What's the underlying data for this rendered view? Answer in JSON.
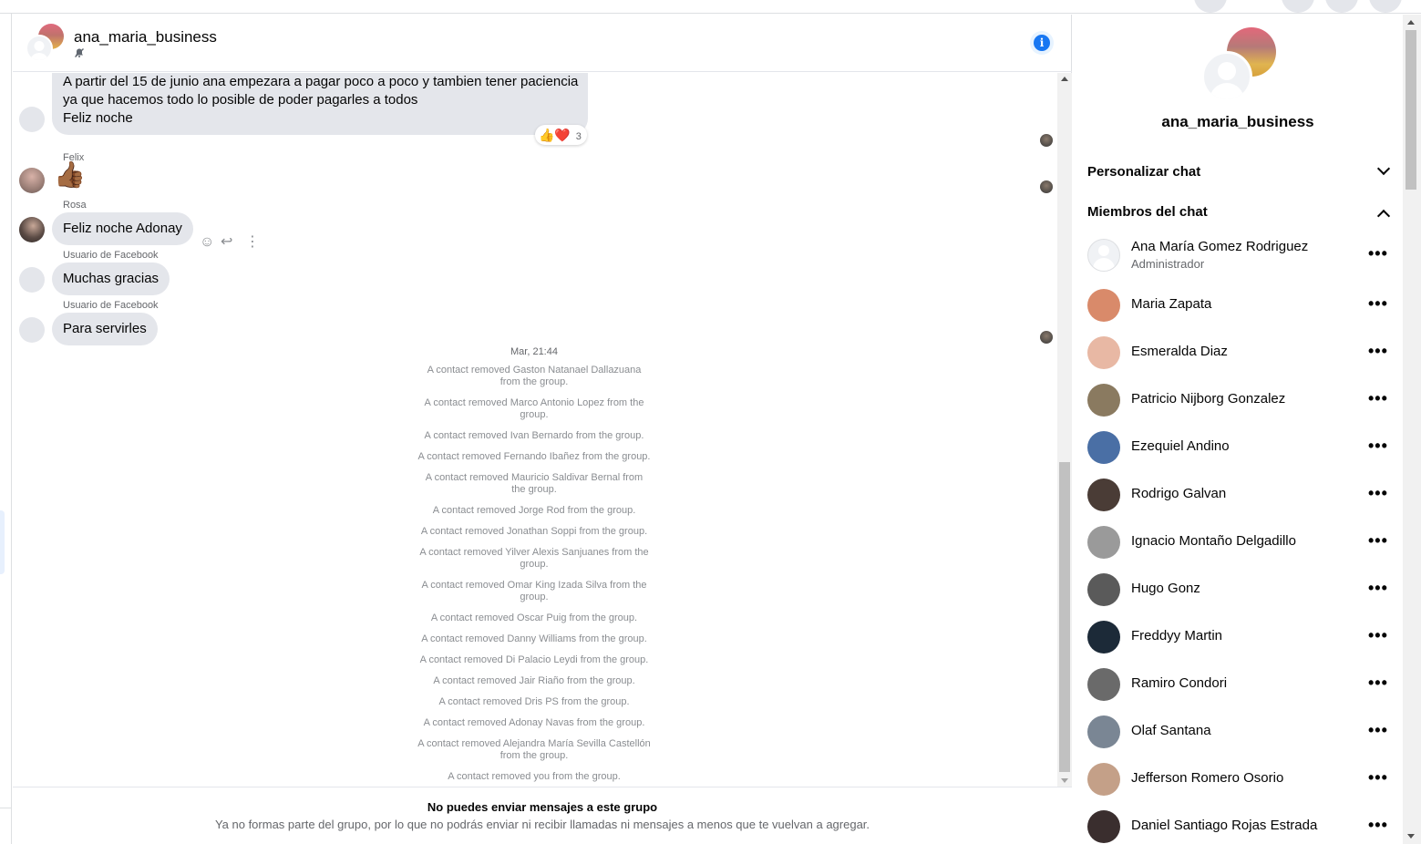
{
  "header": {
    "group_name": "ana_maria_business",
    "muted_icon": "bell-slash-icon",
    "info_icon": "info-icon",
    "info_label": "i"
  },
  "messages": {
    "first_bubble_lines": [
      "A partir del 15 de junio ana empezara a pagar poco a poco y tambien tener paciencia",
      "ya que hacemos todo lo posible de poder pagarles a todos",
      "Feliz noche"
    ],
    "reactions": {
      "emojis": "👍❤️",
      "count": "3"
    },
    "felix": {
      "sender": "Felix",
      "content": "👍🏾"
    },
    "rosa": {
      "sender": "Rosa",
      "text": "Feliz noche Adonay"
    },
    "fb1": {
      "sender": "Usuario de Facebook",
      "text": "Muchas gracias"
    },
    "fb2": {
      "sender": "Usuario de Facebook",
      "text": "Para servirles"
    },
    "action_icons": [
      "emoji-icon",
      "reply-icon",
      "more-vertical-icon"
    ]
  },
  "system": {
    "timestamp": "Mar, 21:44",
    "events": [
      [
        "A contact removed Gaston Natanael Dallazuana",
        "from the group."
      ],
      [
        "A contact removed Marco Antonio Lopez from the",
        "group."
      ],
      [
        "A contact removed Ivan Bernardo from the group."
      ],
      [
        "A contact removed Fernando Ibañez from the group."
      ],
      [
        "A contact removed Mauricio Saldivar Bernal from",
        "the group."
      ],
      [
        "A contact removed Jorge Rod from the group."
      ],
      [
        "A contact removed Jonathan Soppi from the group."
      ],
      [
        "A contact removed Yilver Alexis Sanjuanes from the",
        "group."
      ],
      [
        "A contact removed Omar King Izada Silva from the",
        "group."
      ],
      [
        "A contact removed Oscar Puig from the group."
      ],
      [
        "A contact removed Danny Williams from the group."
      ],
      [
        "A contact removed Di Palacio Leydi from the group."
      ],
      [
        "A contact removed Jair Riaño from the group."
      ],
      [
        "A contact removed Dris PS from the group."
      ],
      [
        "A contact removed Adonay Navas from the group."
      ],
      [
        "A contact removed Alejandra María Sevilla Castellón",
        "from the group."
      ],
      [
        "A contact removed you from the group."
      ]
    ]
  },
  "footer": {
    "title": "No puedes enviar mensajes a este grupo",
    "subtitle": "Ya no formas parte del grupo, por lo que no podrás enviar ni recibir llamadas ni mensajes a menos que te vuelvan a agregar."
  },
  "panel": {
    "name": "ana_maria_business",
    "customize_label": "Personalizar chat",
    "members_label": "Miembros del chat",
    "more_label": "•••",
    "members": [
      {
        "name": "Ana María Gomez Rodriguez",
        "role": "Administrador",
        "color": "#f0f2f5"
      },
      {
        "name": "Maria Zapata",
        "role": "",
        "color": "#d98a6a"
      },
      {
        "name": "Esmeralda Diaz",
        "role": "",
        "color": "#e8b8a4"
      },
      {
        "name": "Patricio Nijborg Gonzalez",
        "role": "",
        "color": "#8a7a60"
      },
      {
        "name": "Ezequiel Andino",
        "role": "",
        "color": "#4a6fa5"
      },
      {
        "name": "Rodrigo Galvan",
        "role": "",
        "color": "#4a3c36"
      },
      {
        "name": "Ignacio Montaño Delgadillo",
        "role": "",
        "color": "#9a9a9a"
      },
      {
        "name": "Hugo Gonz",
        "role": "",
        "color": "#5a5a5a"
      },
      {
        "name": "Freddyy Martin",
        "role": "",
        "color": "#1c2a38"
      },
      {
        "name": "Ramiro Condori",
        "role": "",
        "color": "#6a6a6a"
      },
      {
        "name": "Olaf Santana",
        "role": "",
        "color": "#7a8694"
      },
      {
        "name": "Jefferson Romero Osorio",
        "role": "",
        "color": "#c4a088"
      },
      {
        "name": "Daniel Santiago Rojas Estrada",
        "role": "",
        "color": "#3a2e2e"
      }
    ]
  }
}
